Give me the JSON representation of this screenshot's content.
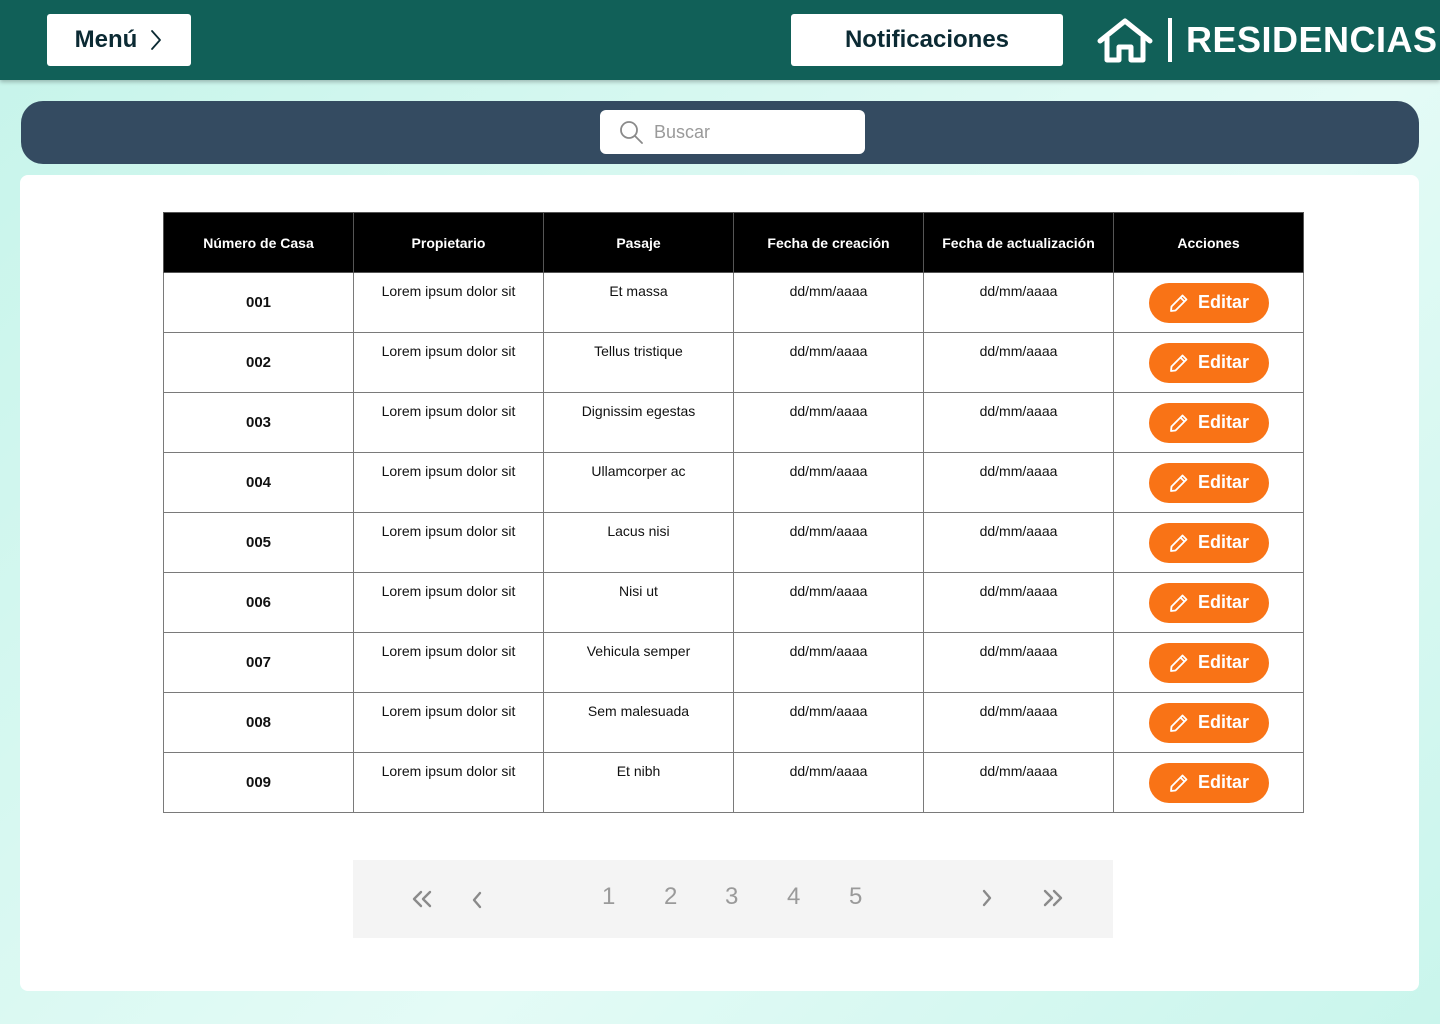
{
  "header": {
    "menu_label": "Menú",
    "notifications_label": "Notificaciones",
    "brand_name": "RESIDENCIAS"
  },
  "search": {
    "placeholder": "Buscar"
  },
  "table": {
    "columns": [
      "Número de Casa",
      "Propietario",
      "Pasaje",
      "Fecha de creación",
      "Fecha de actualización",
      "Acciones"
    ],
    "rows": [
      {
        "num": "001",
        "owner": "Lorem ipsum dolor sit",
        "passage": "Et massa",
        "created": "dd/mm/aaaa",
        "updated": "dd/mm/aaaa",
        "action": "Editar"
      },
      {
        "num": "002",
        "owner": "Lorem ipsum dolor sit",
        "passage": "Tellus tristique",
        "created": "dd/mm/aaaa",
        "updated": "dd/mm/aaaa",
        "action": "Editar"
      },
      {
        "num": "003",
        "owner": "Lorem ipsum dolor sit",
        "passage": "Dignissim egestas",
        "created": "dd/mm/aaaa",
        "updated": "dd/mm/aaaa",
        "action": "Editar"
      },
      {
        "num": "004",
        "owner": "Lorem ipsum dolor sit",
        "passage": "Ullamcorper ac",
        "created": "dd/mm/aaaa",
        "updated": "dd/mm/aaaa",
        "action": "Editar"
      },
      {
        "num": "005",
        "owner": "Lorem ipsum dolor sit",
        "passage": "Lacus nisi",
        "created": "dd/mm/aaaa",
        "updated": "dd/mm/aaaa",
        "action": "Editar"
      },
      {
        "num": "006",
        "owner": "Lorem ipsum dolor sit",
        "passage": "Nisi ut",
        "created": "dd/mm/aaaa",
        "updated": "dd/mm/aaaa",
        "action": "Editar"
      },
      {
        "num": "007",
        "owner": "Lorem ipsum dolor sit",
        "passage": "Vehicula semper",
        "created": "dd/mm/aaaa",
        "updated": "dd/mm/aaaa",
        "action": "Editar"
      },
      {
        "num": "008",
        "owner": "Lorem ipsum dolor sit",
        "passage": "Sem malesuada",
        "created": "dd/mm/aaaa",
        "updated": "dd/mm/aaaa",
        "action": "Editar"
      },
      {
        "num": "009",
        "owner": "Lorem ipsum dolor sit",
        "passage": "Et nibh",
        "created": "dd/mm/aaaa",
        "updated": "dd/mm/aaaa",
        "action": "Editar"
      }
    ]
  },
  "pagination": {
    "pages": [
      "1",
      "2",
      "3",
      "4",
      "5"
    ]
  },
  "colors": {
    "header_bg": "#116058",
    "search_bar_bg": "#344b61",
    "edit_button": "#f97316",
    "table_header_bg": "#000000"
  },
  "icons": [
    "chevron-right-icon",
    "house-icon",
    "search-icon",
    "pencil-icon",
    "double-chevron-left-icon",
    "chevron-left-icon",
    "double-chevron-right-icon"
  ]
}
